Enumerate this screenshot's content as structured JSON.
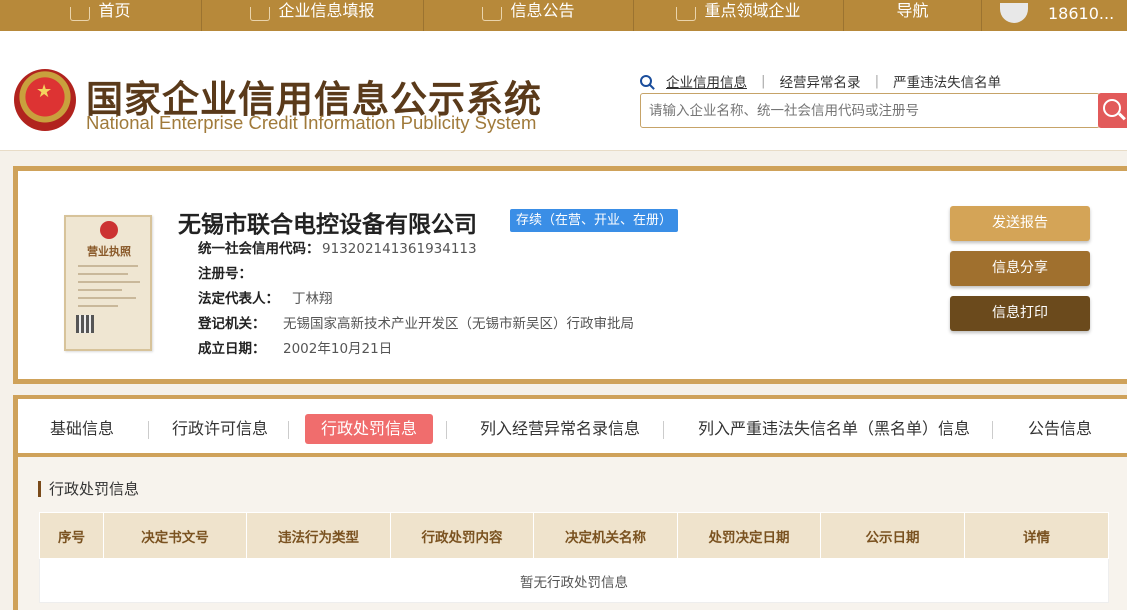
{
  "nav": {
    "items": [
      {
        "label": "首页",
        "icon": "monitor-icon"
      },
      {
        "label": "企业信息填报",
        "icon": "pen-icon"
      },
      {
        "label": "信息公告",
        "icon": "document-icon"
      },
      {
        "label": "重点领域企业",
        "icon": "speaker-icon"
      },
      {
        "label": "导航",
        "icon": ""
      }
    ],
    "user": "18610..."
  },
  "header": {
    "title": "国家企业信用信息公示系统",
    "subtitle": "National Enterprise Credit Information Publicity System",
    "quicklinks": [
      "企业信用信息",
      "经营异常名录",
      "严重违法失信名单"
    ],
    "search_placeholder": "请输入企业名称、统一社会信用代码或注册号"
  },
  "company": {
    "name": "无锡市联合电控设备有限公司",
    "status": "存续（在营、开业、在册）",
    "license_title": "营业执照",
    "fields": [
      {
        "label": "统一社会信用代码：",
        "value": "913202141361934113"
      },
      {
        "label": "注册号：",
        "value": ""
      },
      {
        "label": "法定代表人：",
        "value": "丁林翔"
      },
      {
        "label": "登记机关：",
        "value": "无锡国家高新技术产业开发区（无锡市新吴区）行政审批局"
      },
      {
        "label": "成立日期：",
        "value": "2002年10月21日"
      }
    ],
    "buttons": {
      "report": "发送报告",
      "share": "信息分享",
      "print": "信息打印"
    }
  },
  "tabs": [
    "基础信息",
    "行政许可信息",
    "行政处罚信息",
    "列入经营异常名录信息",
    "列入严重违法失信名单（黑名单）信息",
    "公告信息"
  ],
  "active_tab": "行政处罚信息",
  "penalty": {
    "title": "行政处罚信息",
    "columns": [
      "序号",
      "决定书文号",
      "违法行为类型",
      "行政处罚内容",
      "决定机关名称",
      "处罚决定日期",
      "公示日期",
      "详情"
    ],
    "empty_text": "暂无行政处罚信息"
  },
  "colors": {
    "brand_gold": "#b7893a",
    "active_tab": "#f06d6d",
    "status_blue": "#3a8ee6"
  }
}
